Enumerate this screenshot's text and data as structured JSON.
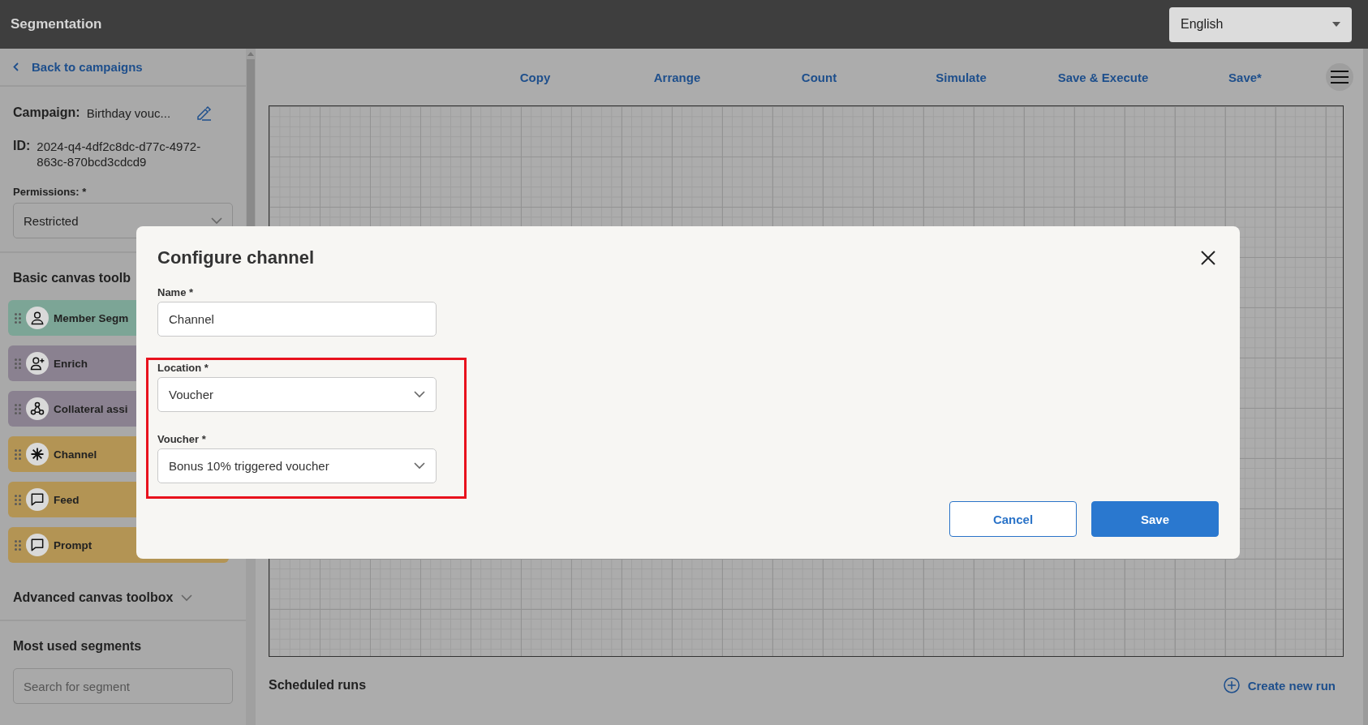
{
  "header": {
    "title": "Segmentation",
    "language": "English"
  },
  "sidebar": {
    "back_link": "Back to campaigns",
    "campaign": {
      "label": "Campaign:",
      "value": "Birthday vouc..."
    },
    "id": {
      "label": "ID:",
      "value": "2024-q4-4df2c8dc-d77c-4972-863c-870bcd3cdcd9"
    },
    "permissions": {
      "label": "Permissions: *",
      "value": "Restricted"
    },
    "basic_toolbox": {
      "title": "Basic canvas toolb",
      "items": [
        {
          "label": "Member Segm",
          "kind": "person",
          "color": "#7ca596"
        },
        {
          "label": "Enrich",
          "kind": "person-plus",
          "color": "#8a8190"
        },
        {
          "label": "Collateral assi",
          "kind": "nodes",
          "color": "#8a8190"
        },
        {
          "label": "Channel",
          "kind": "asterisk",
          "color": "#b39454"
        },
        {
          "label": "Feed",
          "kind": "chat",
          "color": "#b39454"
        },
        {
          "label": "Prompt",
          "kind": "chat",
          "color": "#b39454"
        }
      ]
    },
    "advanced_toolbox": {
      "title": "Advanced canvas toolbox"
    },
    "most_used": {
      "title": "Most used segments",
      "search": {
        "placeholder": "Search for segment"
      }
    }
  },
  "toolbar": [
    "Copy",
    "Arrange",
    "Count",
    "Simulate",
    "Save & Execute",
    "Save*"
  ],
  "scheduled_runs": {
    "title": "Scheduled runs",
    "create_link": "Create new run"
  },
  "dialog": {
    "title": "Configure channel",
    "fields": [
      {
        "label": "Name *",
        "value": "Channel",
        "kind": "text",
        "highlighted": false
      },
      {
        "label": "Location *",
        "value": "Voucher",
        "kind": "select",
        "highlighted": true
      },
      {
        "label": "Voucher *",
        "value": "Bonus 10% triggered voucher",
        "kind": "select",
        "highlighted": true
      }
    ],
    "buttons": [
      {
        "label": "Cancel",
        "kind": "secondary"
      },
      {
        "label": "Save",
        "kind": "primary"
      }
    ]
  }
}
